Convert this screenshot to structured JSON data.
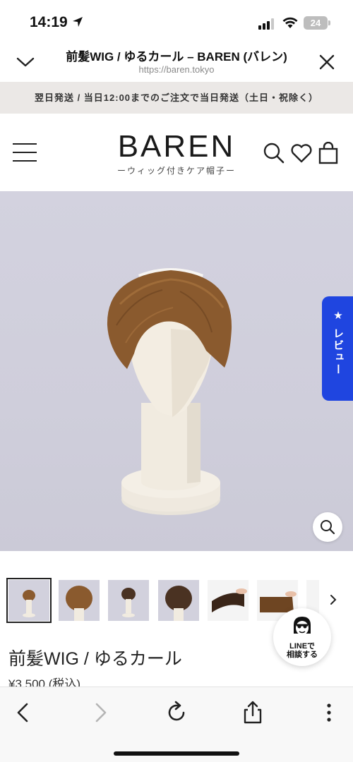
{
  "status_bar": {
    "time": "14:19",
    "battery": "24"
  },
  "browser": {
    "page_title": "前髪WIG / ゆるカール – BAREN (バレン)",
    "url": "https://baren.tokyo"
  },
  "announcement": "翌日発送 / 当日12:00までのご注文で当日発送（土日・祝除く）",
  "header": {
    "logo": "BAREN",
    "tagline": "ーウィッグ付きケア帽子ー"
  },
  "review_tab": "★ レビュー",
  "product": {
    "title": "前髪WIG / ゆるカール",
    "price": "¥3,500 (税込)"
  },
  "line_chat": {
    "label_line1": "LINEで",
    "label_line2": "相談する"
  },
  "thumbnails": [
    {
      "name": "thumb-1"
    },
    {
      "name": "thumb-2"
    },
    {
      "name": "thumb-3"
    },
    {
      "name": "thumb-4"
    },
    {
      "name": "thumb-5"
    },
    {
      "name": "thumb-6"
    },
    {
      "name": "thumb-7"
    }
  ],
  "icons": {
    "collapse": "chevron-down-icon",
    "close": "close-icon",
    "menu": "hamburger-menu-icon",
    "search": "search-icon",
    "wishlist": "heart-icon",
    "cart": "shopping-bag-icon",
    "zoom": "zoom-icon",
    "back": "back-arrow-icon",
    "forward": "forward-arrow-icon",
    "reload": "reload-icon",
    "share": "share-icon",
    "more": "more-icon"
  },
  "colors": {
    "announcement_bg": "#ebe8e6",
    "review_tab": "#1f45e0",
    "image_bg": "#d3d2df",
    "wig": "#8a5a2e"
  }
}
